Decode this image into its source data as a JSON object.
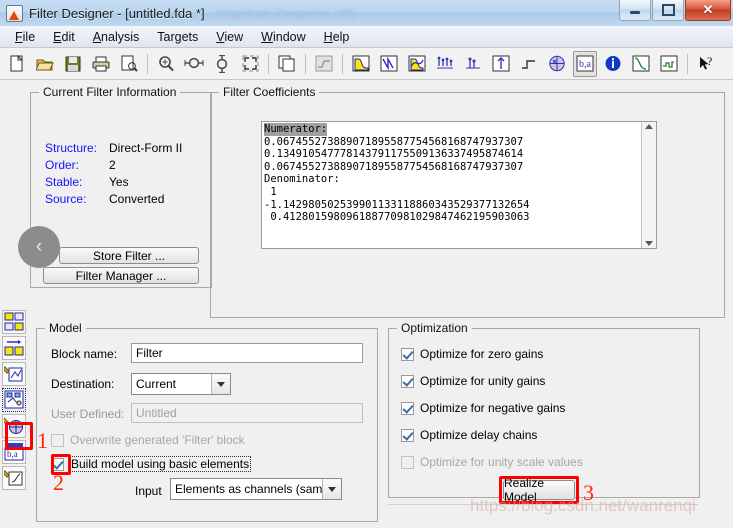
{
  "window": {
    "title": "Filter Designer -  [untitled.fda *]",
    "ghost_title": "Magnitude Response (dB)",
    "icon": "filter-designer-icon",
    "buttons": {
      "minimize": "—",
      "maximize": "❐",
      "close": "✕"
    }
  },
  "menu": {
    "items": [
      {
        "label": "File",
        "accel": "F"
      },
      {
        "label": "Edit",
        "accel": "E"
      },
      {
        "label": "Analysis",
        "accel": "A"
      },
      {
        "label": "Targets",
        "accel": "g"
      },
      {
        "label": "View",
        "accel": "V"
      },
      {
        "label": "Window",
        "accel": "W"
      },
      {
        "label": "Help",
        "accel": "H"
      }
    ]
  },
  "toolbar": {
    "buttons": [
      {
        "name": "new-icon",
        "label": "New"
      },
      {
        "name": "open-icon",
        "label": "Open"
      },
      {
        "name": "save-icon",
        "label": "Save"
      },
      {
        "name": "print-icon",
        "label": "Print"
      },
      {
        "name": "print-preview-icon",
        "label": "Print Preview"
      },
      {
        "name": "zoom-in-icon",
        "label": "Zoom In"
      },
      {
        "name": "zoom-x-icon",
        "label": "Zoom X"
      },
      {
        "name": "zoom-y-icon",
        "label": "Zoom Y"
      },
      {
        "name": "full-view-icon",
        "label": "Restore Default View"
      },
      {
        "name": "copy-figure-icon",
        "label": "Copy Figure"
      },
      {
        "name": "filter-spec-icon",
        "label": "Filter Specifications"
      },
      {
        "name": "magnitude-response-icon",
        "label": "Magnitude Response"
      },
      {
        "name": "phase-response-icon",
        "label": "Phase Response"
      },
      {
        "name": "magnitude-phase-icon",
        "label": "Magnitude and Phase Response"
      },
      {
        "name": "group-delay-icon",
        "label": "Group Delay Response"
      },
      {
        "name": "phase-delay-icon",
        "label": "Phase Delay"
      },
      {
        "name": "impulse-response-icon",
        "label": "Impulse Response"
      },
      {
        "name": "step-response-icon",
        "label": "Step Response"
      },
      {
        "name": "pole-zero-icon",
        "label": "Pole/Zero Plot"
      },
      {
        "name": "filter-coefficients-icon",
        "label": "Filter Coefficients"
      },
      {
        "name": "filter-information-icon",
        "label": "Filter Information"
      },
      {
        "name": "magnitude-estimate-icon",
        "label": "Magnitude Response Estimate"
      },
      {
        "name": "round-off-noise-icon",
        "label": "Round-off Noise Power Spectrum"
      },
      {
        "name": "context-help-icon",
        "label": "What's This?"
      }
    ]
  },
  "sidebar": {
    "items": [
      {
        "name": "sidebar-item-design-filter",
        "label": "Design Filter"
      },
      {
        "name": "sidebar-item-import-filter",
        "label": "Import Filter"
      },
      {
        "name": "sidebar-item-quantize-filter",
        "label": "Set Quantization Parameters"
      },
      {
        "name": "sidebar-item-realize-model",
        "label": "Realize Model"
      },
      {
        "name": "sidebar-item-transform-filter",
        "label": "Transform Filter"
      },
      {
        "name": "sidebar-item-multirate-filter",
        "label": "Create a Multirate Filter"
      },
      {
        "name": "sidebar-item-pole-zero-editor",
        "label": "Pole/Zero Editor"
      }
    ],
    "selected_index": 3
  },
  "current_filter_information": {
    "legend": "Current Filter Information",
    "fields": [
      {
        "key": "Structure:",
        "value": "Direct-Form II"
      },
      {
        "key": "Order:",
        "value": "2"
      },
      {
        "key": "Stable:",
        "value": "Yes"
      },
      {
        "key": "Source:",
        "value": "Converted"
      }
    ],
    "store_filter_button": "Store Filter ...",
    "filter_manager_button": "Filter Manager ...",
    "collapse_icon": "chevron-left-icon"
  },
  "filter_coefficients": {
    "legend": "Filter Coefficients",
    "header_line": "Numerator:",
    "lines": [
      "0.067455273889071895587754568168747937307",
      "0.134910547778143791175509136337495874614",
      "0.067455273889071895587754568168747937307"
    ],
    "denominator_header": "Denominator:",
    "denominator_lines": [
      " 1",
      "-1.142980502539901133118860343529377132654",
      " 0.412801598096188770981029847462195903063"
    ]
  },
  "model_panel": {
    "legend": "Model",
    "block_name_label": "Block name:",
    "block_name_value": "Filter",
    "destination_label": "Destination:",
    "destination_value": "Current",
    "user_defined_label": "User Defined:",
    "user_defined_value": "Untitled",
    "overwrite_label": "Overwrite generated 'Filter' block",
    "overwrite_checked": false,
    "build_basic_label": "Build model using basic elements",
    "build_basic_checked": true,
    "input_label": "Input",
    "input_value": "Elements as channels (sample ba..."
  },
  "optimization_panel": {
    "legend": "Optimization",
    "options": [
      {
        "label": "Optimize for zero gains",
        "checked": true,
        "enabled": true
      },
      {
        "label": "Optimize for unity gains",
        "checked": true,
        "enabled": true
      },
      {
        "label": "Optimize for negative gains",
        "checked": true,
        "enabled": true
      },
      {
        "label": "Optimize delay chains",
        "checked": true,
        "enabled": true
      },
      {
        "label": "Optimize for unity scale values",
        "checked": false,
        "enabled": false
      }
    ]
  },
  "realize_model_button": "Realize Model",
  "annotations": [
    {
      "number": "1",
      "target": "sidebar-item-realize-model"
    },
    {
      "number": "2",
      "target": "build-model-basic-elements-checkbox"
    },
    {
      "number": "3",
      "target": "realize-model-button"
    }
  ],
  "watermark": "https://blog.csdn.net/wanrenqi",
  "colors": {
    "accent_blue": "#1414ff",
    "annotation_red": "#ff2a00",
    "window_bg": "#f0f0f0",
    "titlebar": "#bcd7ef"
  }
}
